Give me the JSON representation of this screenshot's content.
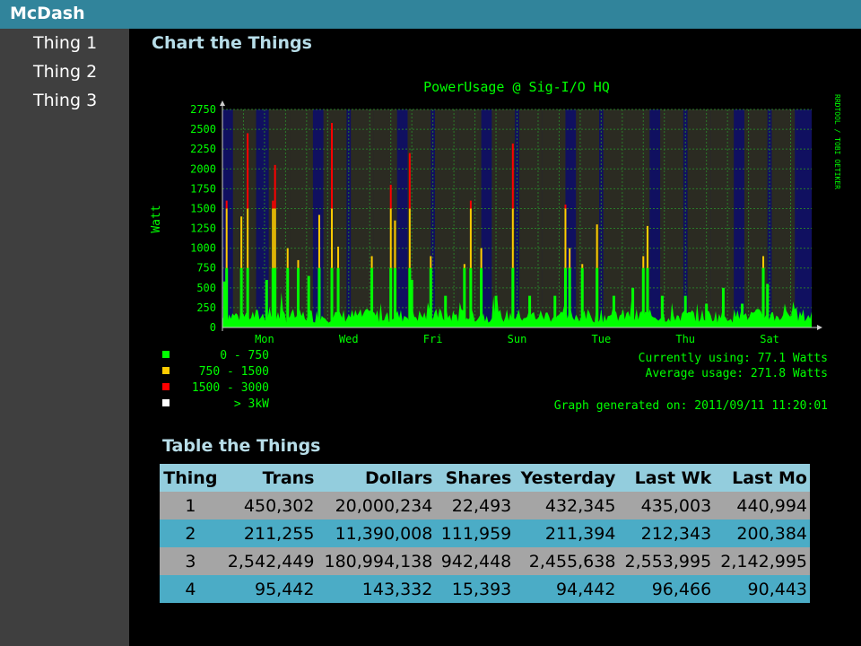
{
  "app": {
    "title": "McDash"
  },
  "sidebar": {
    "items": [
      {
        "label": "Thing 1"
      },
      {
        "label": "Thing 2"
      },
      {
        "label": "Thing 3"
      }
    ]
  },
  "sections": {
    "chart_title": "Chart the Things",
    "table_title": "Table the Things"
  },
  "colors": {
    "topbar": "#31849b",
    "sidebar": "#3f3f3f",
    "section_title": "#b7dde8",
    "header_row": "#93cddd",
    "row_odd": "#a5a5a5",
    "row_even": "#4bacc6",
    "chart_green": "#00ff00",
    "chart_yellow": "#ffcc00",
    "chart_red": "#ff0000"
  },
  "chart_data": {
    "type": "area",
    "title": "PowerUsage @ Sig-I/O HQ",
    "ylabel": "Watt",
    "side_label": "RRDTOOL / TOBI OETIKER",
    "ylim": [
      0,
      2750
    ],
    "yticks": [
      0,
      250,
      500,
      750,
      1000,
      1250,
      1500,
      1750,
      2000,
      2250,
      2500,
      2750
    ],
    "x_labels": [
      "Mon",
      "Wed",
      "Fri",
      "Sun",
      "Tue",
      "Thu",
      "Sat"
    ],
    "x_range_days": [
      0,
      14
    ],
    "x_label_days": [
      1,
      3,
      5,
      7,
      9,
      11,
      13
    ],
    "legend": [
      {
        "label": "0 -  750",
        "color": "#00ff00"
      },
      {
        "label": "750 - 1500",
        "color": "#ffcc00"
      },
      {
        "label": "1500 - 3000",
        "color": "#ff0000"
      },
      {
        "label": "> 3kW",
        "color": "#ffffff"
      }
    ],
    "info": {
      "current": "Currently using: 77.1 Watts",
      "average": "Average usage:    271.8 Watts",
      "generated": "Graph generated on: 2011/09/11 11:20:01"
    },
    "spikes": [
      {
        "day": 0.05,
        "value": 580
      },
      {
        "day": 0.1,
        "value": 1600
      },
      {
        "day": 0.45,
        "value": 1400
      },
      {
        "day": 0.6,
        "value": 2450
      },
      {
        "day": 1.05,
        "value": 600
      },
      {
        "day": 1.2,
        "value": 1600
      },
      {
        "day": 1.25,
        "value": 2050
      },
      {
        "day": 1.55,
        "value": 1000
      },
      {
        "day": 1.8,
        "value": 850
      },
      {
        "day": 2.05,
        "value": 650
      },
      {
        "day": 2.3,
        "value": 1420
      },
      {
        "day": 2.6,
        "value": 2580
      },
      {
        "day": 2.75,
        "value": 1020
      },
      {
        "day": 3.55,
        "value": 900
      },
      {
        "day": 4.0,
        "value": 1800
      },
      {
        "day": 4.1,
        "value": 1350
      },
      {
        "day": 4.45,
        "value": 2200
      },
      {
        "day": 4.5,
        "value": 600
      },
      {
        "day": 4.95,
        "value": 900
      },
      {
        "day": 5.3,
        "value": 400
      },
      {
        "day": 5.75,
        "value": 800
      },
      {
        "day": 5.9,
        "value": 1600
      },
      {
        "day": 6.15,
        "value": 1000
      },
      {
        "day": 6.5,
        "value": 400
      },
      {
        "day": 6.9,
        "value": 2320
      },
      {
        "day": 7.3,
        "value": 400
      },
      {
        "day": 7.9,
        "value": 400
      },
      {
        "day": 8.15,
        "value": 1550
      },
      {
        "day": 8.25,
        "value": 1000
      },
      {
        "day": 8.55,
        "value": 800
      },
      {
        "day": 8.9,
        "value": 1300
      },
      {
        "day": 9.3,
        "value": 400
      },
      {
        "day": 9.75,
        "value": 500
      },
      {
        "day": 10.0,
        "value": 900
      },
      {
        "day": 10.1,
        "value": 1280
      },
      {
        "day": 10.45,
        "value": 400
      },
      {
        "day": 11.0,
        "value": 400
      },
      {
        "day": 11.5,
        "value": 300
      },
      {
        "day": 11.9,
        "value": 500
      },
      {
        "day": 12.35,
        "value": 300
      },
      {
        "day": 12.85,
        "value": 900
      },
      {
        "day": 12.95,
        "value": 550
      },
      {
        "day": 13.55,
        "value": 200
      }
    ]
  },
  "table": {
    "columns": [
      "Thing",
      "Trans",
      "Dollars",
      "Shares",
      "Yesterday",
      "Last Wk",
      "Last Mo"
    ],
    "rows": [
      [
        "1",
        "450,302",
        "20,000,234",
        "22,493",
        "432,345",
        "435,003",
        "440,994"
      ],
      [
        "2",
        "211,255",
        "11,390,008",
        "111,959",
        "211,394",
        "212,343",
        "200,384"
      ],
      [
        "3",
        "2,542,449",
        "180,994,138",
        "942,448",
        "2,455,638",
        "2,553,995",
        "2,142,995"
      ],
      [
        "4",
        "95,442",
        "143,332",
        "15,393",
        "94,442",
        "96,466",
        "90,443"
      ]
    ]
  }
}
